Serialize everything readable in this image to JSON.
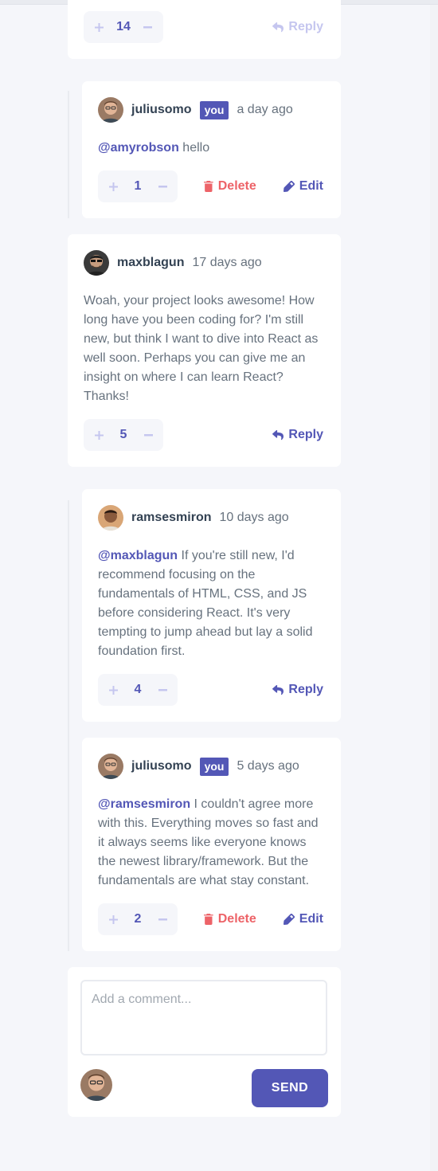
{
  "top_card": {
    "score": "14",
    "reply_label": "Reply"
  },
  "comments": {
    "c1": {
      "username": "juliusomo",
      "badge": "you",
      "time": "a day ago",
      "mention": "@amyrobson",
      "text": " hello",
      "score": "1",
      "delete_label": "Delete",
      "edit_label": "Edit"
    },
    "c2": {
      "username": "maxblagun",
      "time": "17 days ago",
      "text": "Woah, your project looks awesome! How long have you been coding for? I'm still new, but think I want to dive into React as well soon. Perhaps you can give me an insight on where I can learn React? Thanks!",
      "score": "5",
      "reply_label": "Reply"
    },
    "c3": {
      "username": "ramsesmiron",
      "time": "10 days ago",
      "mention": "@maxblagun",
      "text": " If you're still new, I'd recommend focusing on the fundamentals of HTML, CSS, and JS before considering React. It's very tempting to jump ahead but lay a solid foundation first.",
      "score": "4",
      "reply_label": "Reply"
    },
    "c4": {
      "username": "juliusomo",
      "badge": "you",
      "time": "5 days ago",
      "mention": "@ramsesmiron",
      "text": " I couldn't agree more with this. Everything moves so fast and it always seems like everyone knows the newest library/framework. But the fundamentals are what stay constant.",
      "score": "2",
      "delete_label": "Delete",
      "edit_label": "Edit"
    }
  },
  "composer": {
    "placeholder": "Add a comment...",
    "send_label": "SEND"
  },
  "icons": {
    "upvote": "plus-icon",
    "downvote": "minus-icon",
    "reply": "reply-icon",
    "delete": "trash-icon",
    "edit": "pencil-icon"
  },
  "colors": {
    "accent": "#5357b6",
    "accent_light": "#c5c6ef",
    "danger": "#ed6368",
    "text": "#67727e",
    "heading": "#334253",
    "background": "#f5f6fa"
  }
}
